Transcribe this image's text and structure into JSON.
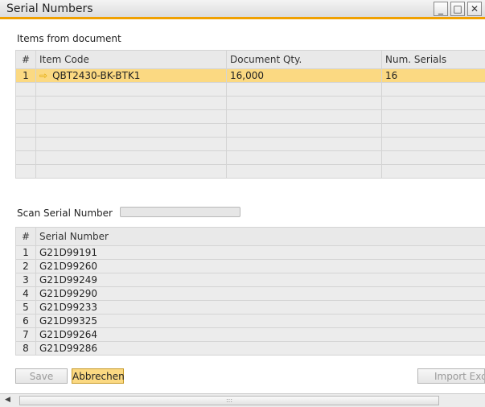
{
  "window": {
    "title": "Serial Numbers",
    "minimize_glyph": "_",
    "maximize_glyph": "□",
    "close_glyph": "✕"
  },
  "items_section": {
    "label": "Items from document",
    "columns": [
      "#",
      "Item Code",
      "Document Qty.",
      "Num. Serials"
    ],
    "rows": [
      {
        "num": "1",
        "item_code": "QBT2430-BK-BTK1",
        "doc_qty": "16,000",
        "num_serials": "16"
      }
    ],
    "link_icon": "orange-link-arrow-icon"
  },
  "scan": {
    "label": "Scan Serial Number",
    "value": ""
  },
  "serials_section": {
    "columns": [
      "#",
      "Serial Number"
    ],
    "rows": [
      {
        "num": "1",
        "serial": "G21D99191"
      },
      {
        "num": "2",
        "serial": "G21D99260"
      },
      {
        "num": "3",
        "serial": "G21D99249"
      },
      {
        "num": "4",
        "serial": "G21D99290"
      },
      {
        "num": "5",
        "serial": "G21D99233"
      },
      {
        "num": "6",
        "serial": "G21D99325"
      },
      {
        "num": "7",
        "serial": "G21D99264"
      },
      {
        "num": "8",
        "serial": "G21D99286"
      }
    ]
  },
  "buttons": {
    "save": "Save",
    "cancel": "Abbrechen",
    "import": "Import Exc"
  },
  "scrollbar": {
    "left_glyph": "◀",
    "grip_glyph": ":::"
  },
  "colors": {
    "accent": "#f0a000",
    "selected_row": "#fbd982"
  }
}
